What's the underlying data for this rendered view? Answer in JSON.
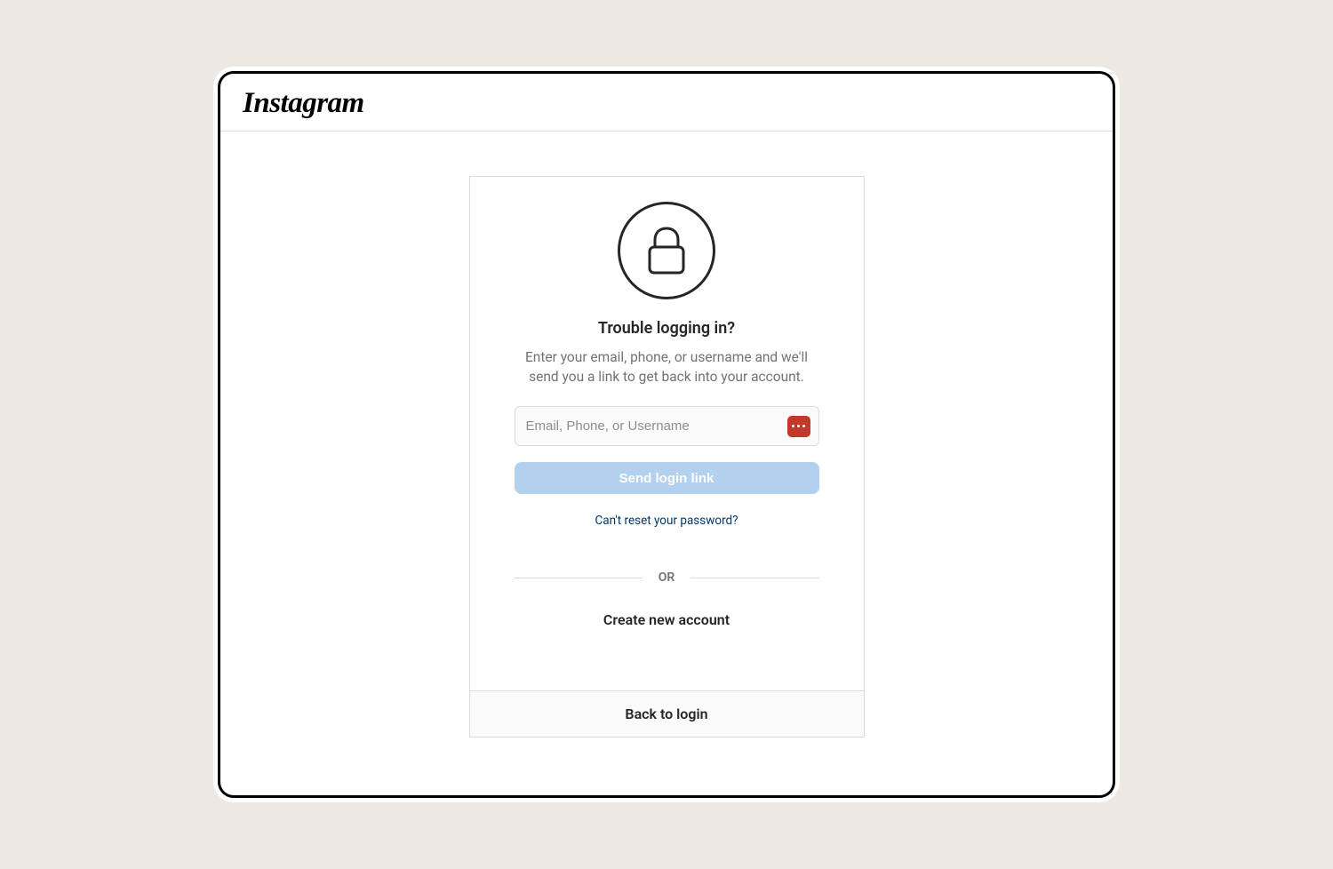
{
  "header": {
    "brand": "Instagram"
  },
  "card": {
    "title": "Trouble logging in?",
    "subtitle": "Enter your email, phone, or username and we'll send you a link to get back into your account.",
    "input_placeholder": "Email, Phone, or Username",
    "submit_label": "Send login link",
    "reset_link": "Can't reset your password?",
    "divider_label": "OR",
    "create_account": "Create new account",
    "back_to_login": "Back to login"
  }
}
